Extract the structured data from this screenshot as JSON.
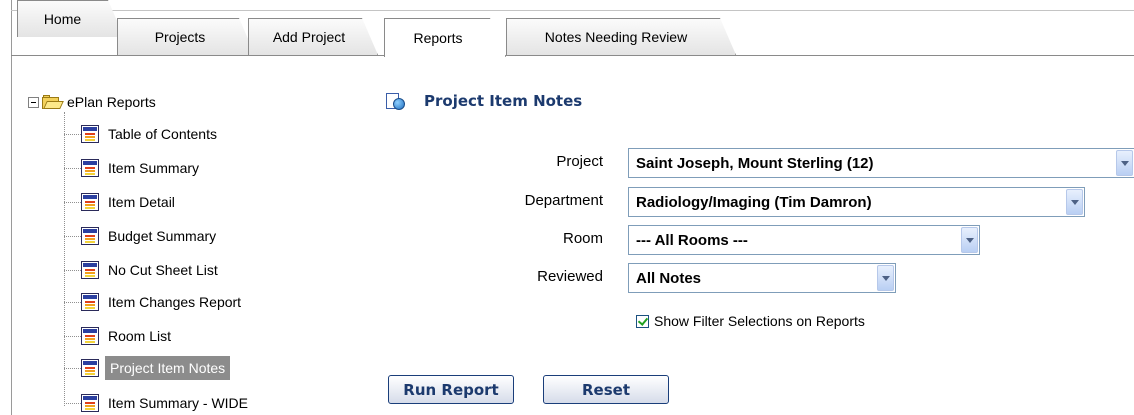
{
  "tabs": [
    {
      "label": "Home",
      "active": false
    },
    {
      "label": "Projects",
      "active": false
    },
    {
      "label": "Add Project",
      "active": false
    },
    {
      "label": "Reports",
      "active": true
    },
    {
      "label": "Notes Needing Review",
      "active": false
    }
  ],
  "tree": {
    "root_label": "ePlan Reports",
    "items": [
      {
        "label": "Table of Contents"
      },
      {
        "label": "Item Summary"
      },
      {
        "label": "Item Detail"
      },
      {
        "label": "Budget Summary"
      },
      {
        "label": "No Cut Sheet List"
      },
      {
        "label": "Item Changes Report"
      },
      {
        "label": "Room List"
      },
      {
        "label": "Project Item Notes",
        "selected": true
      },
      {
        "label": "Item Summary - WIDE"
      }
    ]
  },
  "main": {
    "title": "Project Item Notes",
    "fields": {
      "project": {
        "label": "Project",
        "value": "Saint Joseph, Mount Sterling (12)"
      },
      "department": {
        "label": "Department",
        "value": "Radiology/Imaging (Tim Damron)"
      },
      "room": {
        "label": "Room",
        "value": "--- All Rooms ---"
      },
      "reviewed": {
        "label": "Reviewed",
        "value": "All Notes"
      }
    },
    "show_filters": {
      "label": "Show Filter Selections on Reports",
      "checked": true
    },
    "run_label": "Run Report",
    "reset_label": "Reset"
  },
  "colors": {
    "title": "#1c3a6e",
    "selected_bg": "#8c8c8c",
    "select_border": "#7f9db9"
  }
}
